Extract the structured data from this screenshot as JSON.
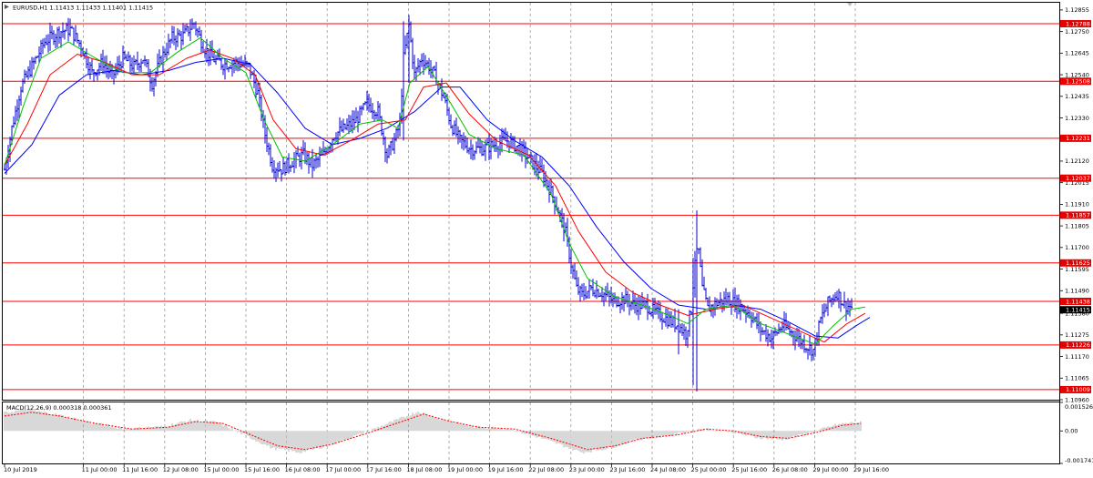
{
  "main_panel": {
    "header": "EURUSD,H1  1.11413 1.11433 1.11401 1.11415",
    "price_axis_ticks": [
      "1.12855",
      "1.12750",
      "1.12645",
      "1.12540",
      "1.12435",
      "1.12330",
      "1.12120",
      "1.12015",
      "1.11910",
      "1.11805",
      "1.11700",
      "1.11595",
      "1.11490",
      "1.11380",
      "1.11275",
      "1.11170",
      "1.11065",
      "1.10960"
    ],
    "horizontal_levels": [
      {
        "value": 1.12788,
        "label": "1.12788"
      },
      {
        "value": 1.12508,
        "label": "1.12508"
      },
      {
        "value": 1.12231,
        "label": "1.12231"
      },
      {
        "value": 1.12037,
        "label": "1.12037"
      },
      {
        "value": 1.11857,
        "label": "1.11857"
      },
      {
        "value": 1.11625,
        "label": "1.11625"
      },
      {
        "value": 1.11438,
        "label": "1.11438"
      },
      {
        "value": 1.11226,
        "label": "1.11226"
      },
      {
        "value": 1.11009,
        "label": "1.11009"
      }
    ],
    "current_price": {
      "value": 1.11415,
      "label": "1.11415"
    }
  },
  "macd_panel": {
    "header": "MACD(12,26,9)  0.000318  0.000361",
    "axis_ticks": [
      "0.001526",
      "0.00",
      "-0.001741"
    ]
  },
  "time_axis": {
    "labels": [
      "10 Jul 2019",
      "11 Jul 00:00",
      "11 Jul 16:00",
      "12 Jul 08:00",
      "15 Jul 00:00",
      "15 Jul 16:00",
      "16 Jul 08:00",
      "17 Jul 00:00",
      "17 Jul 16:00",
      "18 Jul 08:00",
      "19 Jul 00:00",
      "19 Jul 16:00",
      "22 Jul 08:00",
      "23 Jul 00:00",
      "23 Jul 16:00",
      "24 Jul 08:00",
      "25 Jul 00:00",
      "25 Jul 16:00",
      "26 Jul 08:00",
      "29 Jul 00:00",
      "29 Jul 16:00"
    ]
  },
  "colors": {
    "level_line": "#ff0000",
    "level_label_bg": "#e60000",
    "current_label_bg": "#000000",
    "price_bars": "#0000cd",
    "ma_fast": "#00c000",
    "ma_mid": "#ff0000",
    "ma_slow": "#0000ff",
    "macd_histogram": "#b0b0b0",
    "macd_signal": "#ff0000",
    "grid": "#9a9a9a"
  },
  "chart_data": {
    "type": "line",
    "title": "EURUSD,H1",
    "ylim": [
      1.1096,
      1.1289
    ],
    "price_path": [
      [
        0,
        1.1208
      ],
      [
        8,
        1.1228
      ],
      [
        18,
        1.1248
      ],
      [
        30,
        1.1258
      ],
      [
        44,
        1.127
      ],
      [
        60,
        1.1275
      ],
      [
        72,
        1.1276
      ],
      [
        84,
        1.1268
      ],
      [
        96,
        1.1255
      ],
      [
        108,
        1.126
      ],
      [
        118,
        1.1253
      ],
      [
        130,
        1.1262
      ],
      [
        142,
        1.1258
      ],
      [
        152,
        1.1262
      ],
      [
        162,
        1.125
      ],
      [
        172,
        1.1262
      ],
      [
        184,
        1.1272
      ],
      [
        196,
        1.1273
      ],
      [
        208,
        1.1279
      ],
      [
        218,
        1.1268
      ],
      [
        228,
        1.1262
      ],
      [
        240,
        1.1259
      ],
      [
        254,
        1.126
      ],
      [
        268,
        1.1258
      ],
      [
        278,
        1.1245
      ],
      [
        286,
        1.1225
      ],
      [
        294,
        1.121
      ],
      [
        304,
        1.1208
      ],
      [
        316,
        1.1212
      ],
      [
        328,
        1.1215
      ],
      [
        338,
        1.121
      ],
      [
        350,
        1.1215
      ],
      [
        362,
        1.1225
      ],
      [
        374,
        1.1228
      ],
      [
        386,
        1.1232
      ],
      [
        398,
        1.124
      ],
      [
        410,
        1.1236
      ],
      [
        420,
        1.1215
      ],
      [
        428,
        1.1222
      ],
      [
        434,
        1.123
      ],
      [
        438,
        1.1262
      ],
      [
        444,
        1.1278
      ],
      [
        450,
        1.1254
      ],
      [
        458,
        1.1262
      ],
      [
        466,
        1.1258
      ],
      [
        474,
        1.1252
      ],
      [
        482,
        1.1243
      ],
      [
        490,
        1.123
      ],
      [
        500,
        1.1222
      ],
      [
        512,
        1.1218
      ],
      [
        524,
        1.1218
      ],
      [
        538,
        1.122
      ],
      [
        552,
        1.1222
      ],
      [
        566,
        1.1218
      ],
      [
        578,
        1.1212
      ],
      [
        590,
        1.1206
      ],
      [
        600,
        1.1197
      ],
      [
        608,
        1.1188
      ],
      [
        616,
        1.1177
      ],
      [
        622,
        1.1162
      ],
      [
        628,
        1.115
      ],
      [
        634,
        1.1147
      ],
      [
        644,
        1.115
      ],
      [
        656,
        1.1148
      ],
      [
        668,
        1.1144
      ],
      [
        680,
        1.1145
      ],
      [
        692,
        1.1142
      ],
      [
        704,
        1.1142
      ],
      [
        716,
        1.1138
      ],
      [
        728,
        1.1135
      ],
      [
        740,
        1.1132
      ],
      [
        748,
        1.1128
      ],
      [
        754,
        1.114
      ],
      [
        758,
        1.1165
      ],
      [
        762,
        1.1168
      ],
      [
        766,
        1.115
      ],
      [
        772,
        1.114
      ],
      [
        782,
        1.1143
      ],
      [
        794,
        1.1145
      ],
      [
        806,
        1.1142
      ],
      [
        818,
        1.1138
      ],
      [
        830,
        1.113
      ],
      [
        842,
        1.1126
      ],
      [
        854,
        1.1132
      ],
      [
        866,
        1.1128
      ],
      [
        878,
        1.1123
      ],
      [
        888,
        1.112
      ],
      [
        896,
        1.1135
      ],
      [
        904,
        1.1143
      ],
      [
        914,
        1.1148
      ],
      [
        922,
        1.1142
      ],
      [
        930,
        1.1141
      ]
    ],
    "ma_fast": [
      [
        0,
        1.121
      ],
      [
        20,
        1.1238
      ],
      [
        40,
        1.1262
      ],
      [
        70,
        1.127
      ],
      [
        100,
        1.1262
      ],
      [
        130,
        1.1255
      ],
      [
        160,
        1.1255
      ],
      [
        190,
        1.1265
      ],
      [
        215,
        1.1272
      ],
      [
        240,
        1.1262
      ],
      [
        265,
        1.1255
      ],
      [
        285,
        1.1232
      ],
      [
        305,
        1.1214
      ],
      [
        330,
        1.1212
      ],
      [
        360,
        1.122
      ],
      [
        390,
        1.123
      ],
      [
        415,
        1.1232
      ],
      [
        432,
        1.1228
      ],
      [
        445,
        1.125
      ],
      [
        465,
        1.1258
      ],
      [
        490,
        1.124
      ],
      [
        510,
        1.1225
      ],
      [
        540,
        1.1218
      ],
      [
        570,
        1.1215
      ],
      [
        600,
        1.1196
      ],
      [
        620,
        1.1172
      ],
      [
        640,
        1.1155
      ],
      [
        670,
        1.1146
      ],
      [
        700,
        1.1142
      ],
      [
        730,
        1.1137
      ],
      [
        750,
        1.1133
      ],
      [
        770,
        1.114
      ],
      [
        800,
        1.1142
      ],
      [
        830,
        1.1133
      ],
      [
        860,
        1.1128
      ],
      [
        890,
        1.1123
      ],
      [
        910,
        1.1132
      ],
      [
        930,
        1.114
      ],
      [
        945,
        1.1141
      ]
    ],
    "ma_mid": [
      [
        0,
        1.121
      ],
      [
        25,
        1.123
      ],
      [
        50,
        1.1254
      ],
      [
        80,
        1.1264
      ],
      [
        110,
        1.126
      ],
      [
        140,
        1.1254
      ],
      [
        170,
        1.1254
      ],
      [
        200,
        1.1262
      ],
      [
        225,
        1.1266
      ],
      [
        250,
        1.1262
      ],
      [
        275,
        1.1254
      ],
      [
        295,
        1.1232
      ],
      [
        320,
        1.1218
      ],
      [
        350,
        1.1215
      ],
      [
        380,
        1.1222
      ],
      [
        410,
        1.123
      ],
      [
        440,
        1.1232
      ],
      [
        460,
        1.1248
      ],
      [
        485,
        1.125
      ],
      [
        510,
        1.1235
      ],
      [
        540,
        1.1222
      ],
      [
        575,
        1.1215
      ],
      [
        605,
        1.12
      ],
      [
        630,
        1.1178
      ],
      [
        660,
        1.1158
      ],
      [
        690,
        1.1148
      ],
      [
        720,
        1.1142
      ],
      [
        750,
        1.1137
      ],
      [
        780,
        1.114
      ],
      [
        810,
        1.1142
      ],
      [
        840,
        1.1136
      ],
      [
        870,
        1.113
      ],
      [
        900,
        1.1124
      ],
      [
        925,
        1.1133
      ],
      [
        945,
        1.1138
      ]
    ],
    "ma_slow": [
      [
        0,
        1.1206
      ],
      [
        30,
        1.122
      ],
      [
        60,
        1.1244
      ],
      [
        90,
        1.1254
      ],
      [
        120,
        1.1256
      ],
      [
        150,
        1.1254
      ],
      [
        180,
        1.1256
      ],
      [
        210,
        1.126
      ],
      [
        240,
        1.1262
      ],
      [
        270,
        1.1259
      ],
      [
        300,
        1.1245
      ],
      [
        330,
        1.1228
      ],
      [
        360,
        1.122
      ],
      [
        390,
        1.1223
      ],
      [
        420,
        1.1228
      ],
      [
        450,
        1.1236
      ],
      [
        480,
        1.1248
      ],
      [
        500,
        1.1248
      ],
      [
        530,
        1.1232
      ],
      [
        560,
        1.1222
      ],
      [
        590,
        1.1214
      ],
      [
        620,
        1.12
      ],
      [
        650,
        1.118
      ],
      [
        680,
        1.1163
      ],
      [
        710,
        1.115
      ],
      [
        740,
        1.1142
      ],
      [
        770,
        1.114
      ],
      [
        800,
        1.1142
      ],
      [
        830,
        1.114
      ],
      [
        860,
        1.1134
      ],
      [
        890,
        1.1127
      ],
      [
        915,
        1.1126
      ],
      [
        935,
        1.1132
      ],
      [
        950,
        1.1136
      ]
    ],
    "macd_signal": [
      [
        0,
        0.0008
      ],
      [
        30,
        0.001
      ],
      [
        60,
        0.0008
      ],
      [
        100,
        0.0004
      ],
      [
        140,
        0.0001
      ],
      [
        180,
        0.0002
      ],
      [
        210,
        0.0005
      ],
      [
        240,
        0.0004
      ],
      [
        270,
        -0.0002
      ],
      [
        300,
        -0.0008
      ],
      [
        330,
        -0.001
      ],
      [
        360,
        -0.0007
      ],
      [
        400,
        -0.0001
      ],
      [
        430,
        0.0004
      ],
      [
        460,
        0.0009
      ],
      [
        490,
        0.0005
      ],
      [
        520,
        0.0002
      ],
      [
        560,
        0.0001
      ],
      [
        600,
        -0.0004
      ],
      [
        640,
        -0.001
      ],
      [
        670,
        -0.0008
      ],
      [
        700,
        -0.0004
      ],
      [
        740,
        -0.0002
      ],
      [
        770,
        0.0001
      ],
      [
        800,
        0.0
      ],
      [
        830,
        -0.0003
      ],
      [
        860,
        -0.0004
      ],
      [
        890,
        -0.0001
      ],
      [
        920,
        0.0003
      ],
      [
        940,
        0.0004
      ]
    ]
  }
}
